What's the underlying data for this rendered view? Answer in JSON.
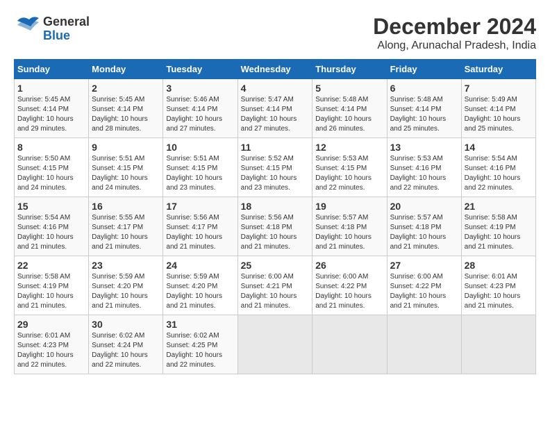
{
  "header": {
    "logo_line1": "General",
    "logo_line2": "Blue",
    "title": "December 2024",
    "subtitle": "Along, Arunachal Pradesh, India"
  },
  "days_of_week": [
    "Sunday",
    "Monday",
    "Tuesday",
    "Wednesday",
    "Thursday",
    "Friday",
    "Saturday"
  ],
  "weeks": [
    [
      {
        "day": "1",
        "sunrise": "5:45 AM",
        "sunset": "4:14 PM",
        "daylight": "10 hours and 29 minutes."
      },
      {
        "day": "2",
        "sunrise": "5:45 AM",
        "sunset": "4:14 PM",
        "daylight": "10 hours and 28 minutes."
      },
      {
        "day": "3",
        "sunrise": "5:46 AM",
        "sunset": "4:14 PM",
        "daylight": "10 hours and 27 minutes."
      },
      {
        "day": "4",
        "sunrise": "5:47 AM",
        "sunset": "4:14 PM",
        "daylight": "10 hours and 27 minutes."
      },
      {
        "day": "5",
        "sunrise": "5:48 AM",
        "sunset": "4:14 PM",
        "daylight": "10 hours and 26 minutes."
      },
      {
        "day": "6",
        "sunrise": "5:48 AM",
        "sunset": "4:14 PM",
        "daylight": "10 hours and 25 minutes."
      },
      {
        "day": "7",
        "sunrise": "5:49 AM",
        "sunset": "4:14 PM",
        "daylight": "10 hours and 25 minutes."
      }
    ],
    [
      {
        "day": "8",
        "sunrise": "5:50 AM",
        "sunset": "4:15 PM",
        "daylight": "10 hours and 24 minutes."
      },
      {
        "day": "9",
        "sunrise": "5:51 AM",
        "sunset": "4:15 PM",
        "daylight": "10 hours and 24 minutes."
      },
      {
        "day": "10",
        "sunrise": "5:51 AM",
        "sunset": "4:15 PM",
        "daylight": "10 hours and 23 minutes."
      },
      {
        "day": "11",
        "sunrise": "5:52 AM",
        "sunset": "4:15 PM",
        "daylight": "10 hours and 23 minutes."
      },
      {
        "day": "12",
        "sunrise": "5:53 AM",
        "sunset": "4:15 PM",
        "daylight": "10 hours and 22 minutes."
      },
      {
        "day": "13",
        "sunrise": "5:53 AM",
        "sunset": "4:16 PM",
        "daylight": "10 hours and 22 minutes."
      },
      {
        "day": "14",
        "sunrise": "5:54 AM",
        "sunset": "4:16 PM",
        "daylight": "10 hours and 22 minutes."
      }
    ],
    [
      {
        "day": "15",
        "sunrise": "5:54 AM",
        "sunset": "4:16 PM",
        "daylight": "10 hours and 21 minutes."
      },
      {
        "day": "16",
        "sunrise": "5:55 AM",
        "sunset": "4:17 PM",
        "daylight": "10 hours and 21 minutes."
      },
      {
        "day": "17",
        "sunrise": "5:56 AM",
        "sunset": "4:17 PM",
        "daylight": "10 hours and 21 minutes."
      },
      {
        "day": "18",
        "sunrise": "5:56 AM",
        "sunset": "4:18 PM",
        "daylight": "10 hours and 21 minutes."
      },
      {
        "day": "19",
        "sunrise": "5:57 AM",
        "sunset": "4:18 PM",
        "daylight": "10 hours and 21 minutes."
      },
      {
        "day": "20",
        "sunrise": "5:57 AM",
        "sunset": "4:18 PM",
        "daylight": "10 hours and 21 minutes."
      },
      {
        "day": "21",
        "sunrise": "5:58 AM",
        "sunset": "4:19 PM",
        "daylight": "10 hours and 21 minutes."
      }
    ],
    [
      {
        "day": "22",
        "sunrise": "5:58 AM",
        "sunset": "4:19 PM",
        "daylight": "10 hours and 21 minutes."
      },
      {
        "day": "23",
        "sunrise": "5:59 AM",
        "sunset": "4:20 PM",
        "daylight": "10 hours and 21 minutes."
      },
      {
        "day": "24",
        "sunrise": "5:59 AM",
        "sunset": "4:20 PM",
        "daylight": "10 hours and 21 minutes."
      },
      {
        "day": "25",
        "sunrise": "6:00 AM",
        "sunset": "4:21 PM",
        "daylight": "10 hours and 21 minutes."
      },
      {
        "day": "26",
        "sunrise": "6:00 AM",
        "sunset": "4:22 PM",
        "daylight": "10 hours and 21 minutes."
      },
      {
        "day": "27",
        "sunrise": "6:00 AM",
        "sunset": "4:22 PM",
        "daylight": "10 hours and 21 minutes."
      },
      {
        "day": "28",
        "sunrise": "6:01 AM",
        "sunset": "4:23 PM",
        "daylight": "10 hours and 21 minutes."
      }
    ],
    [
      {
        "day": "29",
        "sunrise": "6:01 AM",
        "sunset": "4:23 PM",
        "daylight": "10 hours and 22 minutes."
      },
      {
        "day": "30",
        "sunrise": "6:02 AM",
        "sunset": "4:24 PM",
        "daylight": "10 hours and 22 minutes."
      },
      {
        "day": "31",
        "sunrise": "6:02 AM",
        "sunset": "4:25 PM",
        "daylight": "10 hours and 22 minutes."
      },
      null,
      null,
      null,
      null
    ]
  ],
  "labels": {
    "sunrise_prefix": "Sunrise: ",
    "sunset_prefix": "Sunset: ",
    "daylight_prefix": "Daylight: "
  }
}
